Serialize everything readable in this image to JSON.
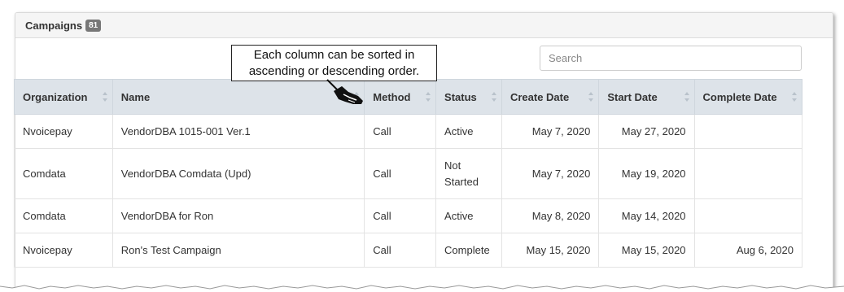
{
  "panel": {
    "title": "Campaigns",
    "count": "81"
  },
  "search": {
    "placeholder": "Search"
  },
  "callout": {
    "line1": "Each column can be sorted in",
    "line2": "ascending or descending order."
  },
  "table": {
    "headers": [
      "Organization",
      "Name",
      "Method",
      "Status",
      "Create Date",
      "Start Date",
      "Complete Date"
    ],
    "rows": [
      {
        "organization": "Nvoicepay",
        "name": "VendorDBA 1015-001 Ver.1",
        "method": "Call",
        "status": "Active",
        "create_date": "May 7, 2020",
        "start_date": "May 27, 2020",
        "complete_date": ""
      },
      {
        "organization": "Comdata",
        "name": "VendorDBA Comdata (Upd)",
        "method": "Call",
        "status": "Not Started",
        "create_date": "May 7, 2020",
        "start_date": "May 19, 2020",
        "complete_date": ""
      },
      {
        "organization": "Comdata",
        "name": "VendorDBA for Ron",
        "method": "Call",
        "status": "Active",
        "create_date": "May 8, 2020",
        "start_date": "May 14, 2020",
        "complete_date": ""
      },
      {
        "organization": "Nvoicepay",
        "name": "Ron's Test Campaign",
        "method": "Call",
        "status": "Complete",
        "create_date": "May 15, 2020",
        "start_date": "May 15, 2020",
        "complete_date": "Aug 6, 2020"
      }
    ]
  },
  "colors": {
    "header_bg": "#dde3e9",
    "badge_bg": "#777777",
    "panel_header_bg": "#f5f5f5"
  },
  "icons": {
    "sort": "sort-both-icon",
    "pointer": "pointing-hand-icon"
  }
}
